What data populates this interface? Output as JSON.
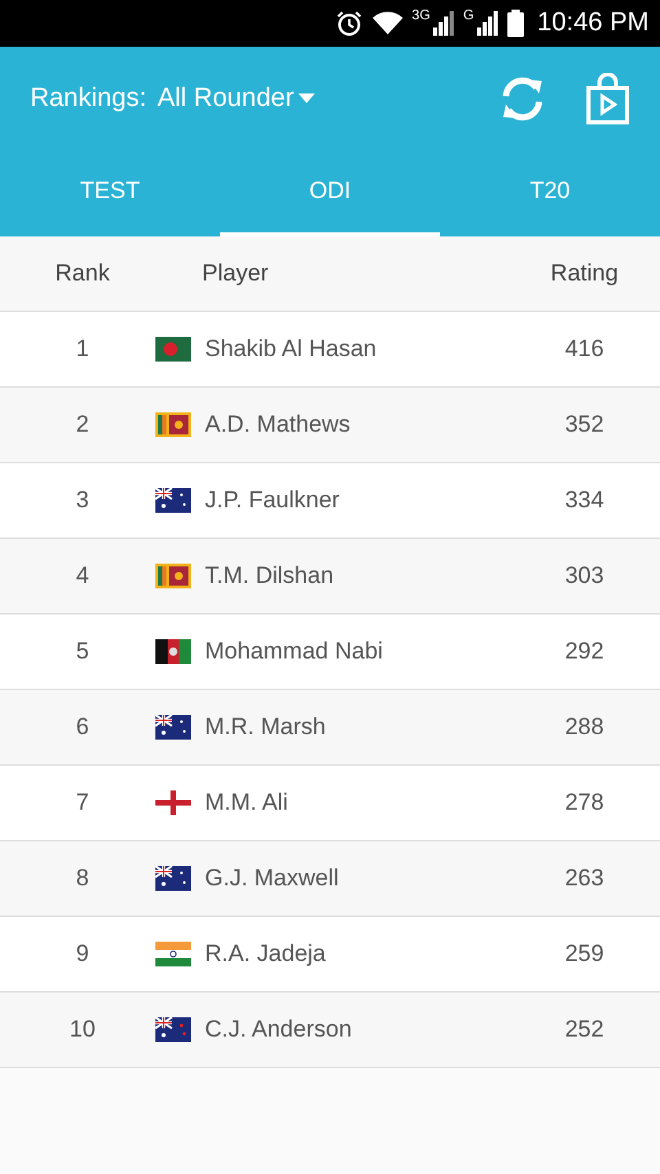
{
  "status_bar": {
    "network_1": "3G",
    "network_2": "G",
    "time": "10:46 PM"
  },
  "header": {
    "title": "Rankings:",
    "dropdown": "All Rounder"
  },
  "tabs": [
    {
      "label": "TEST",
      "selected": false
    },
    {
      "label": "ODI",
      "selected": true
    },
    {
      "label": "T20",
      "selected": false
    }
  ],
  "table": {
    "columns": [
      "Rank",
      "Player",
      "Rating"
    ],
    "rows": [
      {
        "rank": "1",
        "kind": "bd",
        "player": "Shakib Al Hasan",
        "rating": "416"
      },
      {
        "rank": "2",
        "kind": "lk",
        "player": "A.D. Mathews",
        "rating": "352"
      },
      {
        "rank": "3",
        "kind": "au",
        "player": "J.P. Faulkner",
        "rating": "334"
      },
      {
        "rank": "4",
        "kind": "lk",
        "player": "T.M. Dilshan",
        "rating": "303"
      },
      {
        "rank": "5",
        "kind": "af",
        "player": "Mohammad Nabi",
        "rating": "292"
      },
      {
        "rank": "6",
        "kind": "au",
        "player": "M.R. Marsh",
        "rating": "288"
      },
      {
        "rank": "7",
        "kind": "en",
        "player": "M.M. Ali",
        "rating": "278"
      },
      {
        "rank": "8",
        "kind": "au",
        "player": "G.J. Maxwell",
        "rating": "263"
      },
      {
        "rank": "9",
        "kind": "in",
        "player": "R.A. Jadeja",
        "rating": "259"
      },
      {
        "rank": "10",
        "kind": "nz",
        "player": "C.J. Anderson",
        "rating": "252"
      }
    ]
  }
}
